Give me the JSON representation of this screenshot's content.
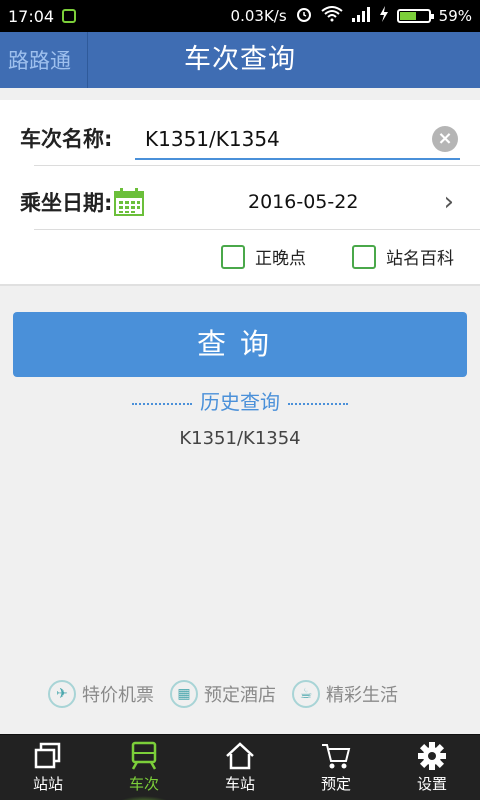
{
  "status_bar": {
    "time": "17:04",
    "network_speed": "0.03K/s",
    "battery": "59%",
    "battery_level": 0.59
  },
  "header": {
    "back_label": "路路通",
    "title": "车次查询"
  },
  "form": {
    "train_label": "车次名称:",
    "train_value": "K1351/K1354",
    "date_label": "乘坐日期:",
    "date_value": "2016-05-22",
    "checkbox_punctuality": "正晚点",
    "checkbox_station_wiki": "站名百科"
  },
  "query_button": "查询",
  "history": {
    "title": "历史查询",
    "items": [
      "K1351/K1354"
    ]
  },
  "quick_links": [
    "特价机票",
    "预定酒店",
    "精彩生活"
  ],
  "tabs": [
    {
      "label": "站站",
      "icon": "station-to-station-icon"
    },
    {
      "label": "车次",
      "icon": "train-icon",
      "active": true
    },
    {
      "label": "车站",
      "icon": "home-icon"
    },
    {
      "label": "预定",
      "icon": "cart-icon"
    },
    {
      "label": "设置",
      "icon": "gear-icon"
    }
  ],
  "colors": {
    "accent": "#3f6db3",
    "button": "#4a90d9",
    "active_tab": "#7ccf3a",
    "checkbox": "#4aa84a"
  }
}
